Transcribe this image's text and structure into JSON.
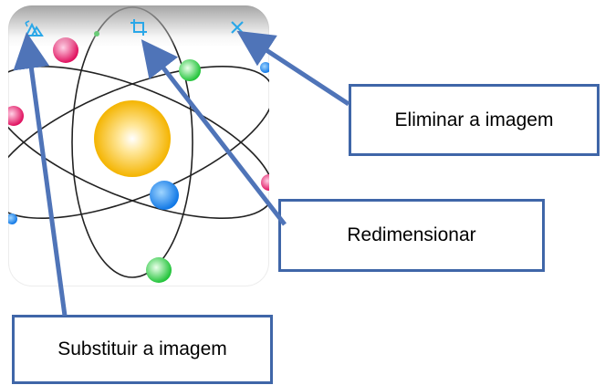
{
  "image_card": {
    "toolbar": {
      "replace_icon": "replace-image-icon",
      "resize_icon": "crop-icon",
      "delete_icon": "close-icon",
      "icon_color": "#2aa7e8"
    },
    "image_description_icon": "atom-icon"
  },
  "callouts": {
    "delete_label": "Eliminar a imagem",
    "resize_label": "Redimensionar",
    "replace_label": "Substituir a imagem"
  },
  "colors": {
    "callout_border": "#3f66a8",
    "arrow": "#4f74b8"
  }
}
